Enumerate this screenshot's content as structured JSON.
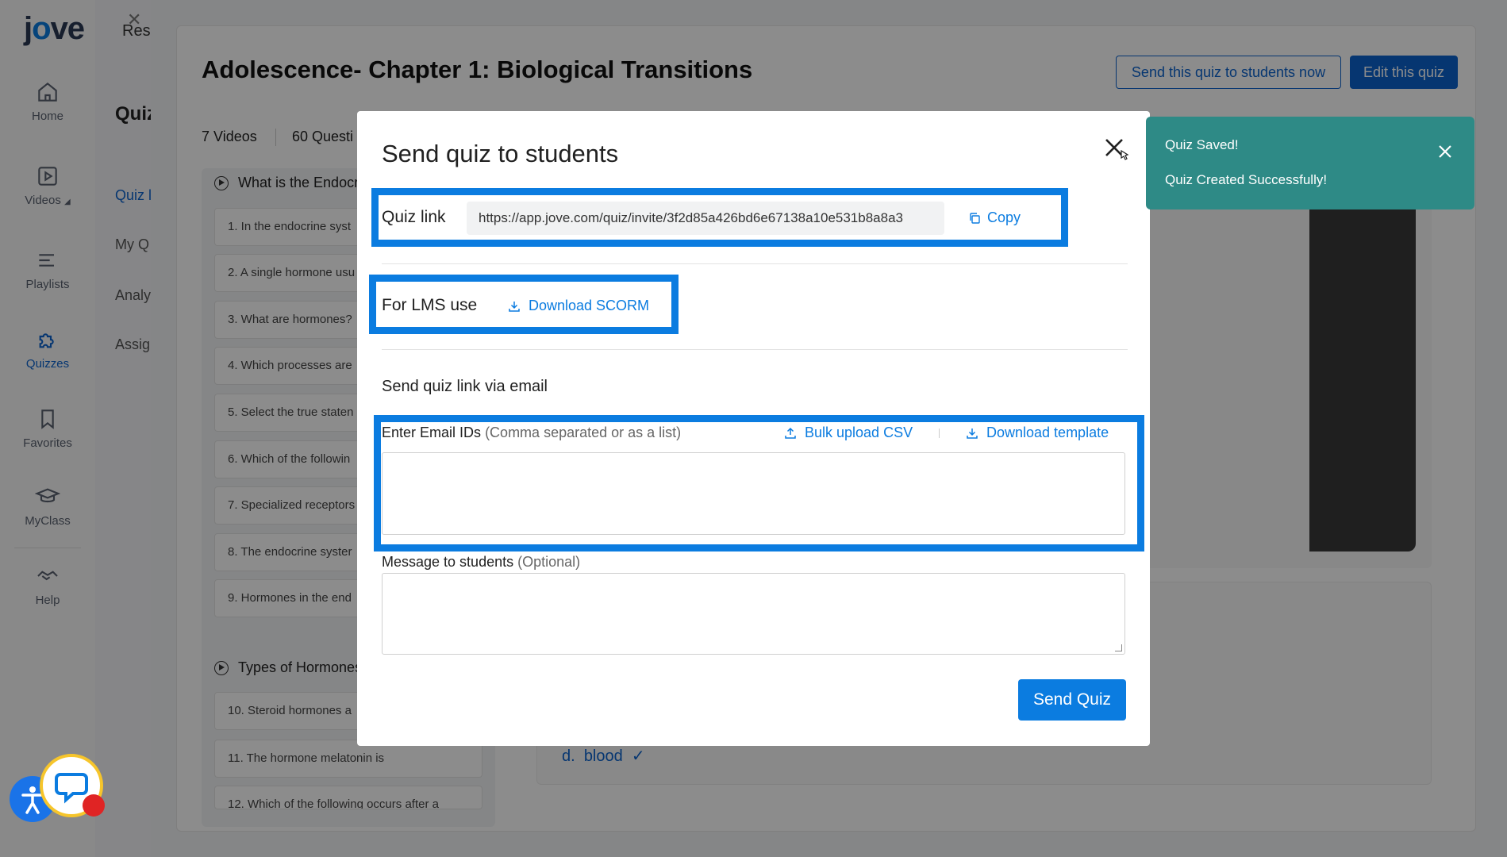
{
  "app": {
    "logo_text": "jove"
  },
  "sidebar": {
    "items": [
      {
        "label": "Home",
        "icon": "home-icon"
      },
      {
        "label": "Videos",
        "icon": "video-icon"
      },
      {
        "label": "Playlists",
        "icon": "playlist-icon"
      },
      {
        "label": "Quizzes",
        "icon": "puzzle-icon"
      },
      {
        "label": "Favorites",
        "icon": "bookmark-icon"
      },
      {
        "label": "MyClass",
        "icon": "graduation-cap-icon"
      },
      {
        "label": "Help",
        "icon": "handshake-icon"
      }
    ],
    "videos_caret": "◢"
  },
  "subnav": {
    "title_partial": "Res",
    "heading_partial": "Quiz",
    "items": [
      "Quiz l",
      "My Q",
      "Analy",
      "Assig"
    ]
  },
  "page": {
    "title": "Adolescence- Chapter 1: Biological Transitions",
    "send_now_label": "Send this quiz to students now",
    "edit_label": "Edit this quiz",
    "videos_count": "7 Videos",
    "questions_count": "60 Questi",
    "sections": [
      {
        "title": "What is the Endocr"
      },
      {
        "title": "Types of Hormones"
      }
    ],
    "questions": [
      "1. In the endocrine syst",
      "2. A single hormone usu",
      "3. What are hormones?",
      "4. Which processes are",
      "5. Select the true staten",
      "6. Which of the followin",
      "7. Specialized receptors",
      "8. The endocrine syster",
      "9. Hormones in the end",
      "10. Steroid hormones a",
      "11. The hormone melatonin is",
      "12. Which of the following occurs after a"
    ],
    "answer": {
      "letter": "d.",
      "text": "blood",
      "mark": "✓"
    }
  },
  "modal": {
    "title": "Send quiz to students",
    "quiz_link_label": "Quiz link",
    "quiz_link_value": "https://app.jove.com/quiz/invite/3f2d85a426bd6e67138a10e531b8a8a3",
    "copy_label": "Copy",
    "lms_label": "For LMS use",
    "download_scorm_label": "Download SCORM",
    "email_section_title": "Send quiz link via email",
    "email_label": "Enter Email IDs",
    "email_hint": "(Comma separated or as a list)",
    "bulk_upload_label": "Bulk upload CSV",
    "download_template_label": "Download template",
    "message_label": "Message to students",
    "message_hint": "(Optional)",
    "send_label": "Send Quiz"
  },
  "toast": {
    "title": "Quiz Saved!",
    "message": "Quiz Created Successfully!"
  },
  "colors": {
    "accent": "#0b7ce0",
    "highlight": "#0b7ce0",
    "toast_bg": "#2e8a86"
  }
}
